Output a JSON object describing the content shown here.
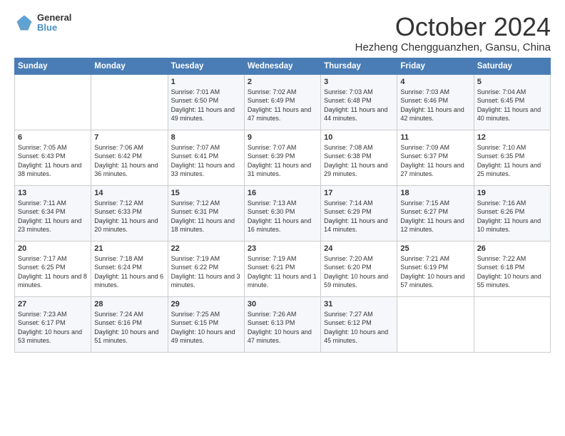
{
  "logo": {
    "general": "General",
    "blue": "Blue"
  },
  "title": "October 2024",
  "location": "Hezheng Chengguanzhen, Gansu, China",
  "weekdays": [
    "Sunday",
    "Monday",
    "Tuesday",
    "Wednesday",
    "Thursday",
    "Friday",
    "Saturday"
  ],
  "weeks": [
    [
      {
        "day": "",
        "sunrise": "",
        "sunset": "",
        "daylight": ""
      },
      {
        "day": "",
        "sunrise": "",
        "sunset": "",
        "daylight": ""
      },
      {
        "day": "1",
        "sunrise": "Sunrise: 7:01 AM",
        "sunset": "Sunset: 6:50 PM",
        "daylight": "Daylight: 11 hours and 49 minutes."
      },
      {
        "day": "2",
        "sunrise": "Sunrise: 7:02 AM",
        "sunset": "Sunset: 6:49 PM",
        "daylight": "Daylight: 11 hours and 47 minutes."
      },
      {
        "day": "3",
        "sunrise": "Sunrise: 7:03 AM",
        "sunset": "Sunset: 6:48 PM",
        "daylight": "Daylight: 11 hours and 44 minutes."
      },
      {
        "day": "4",
        "sunrise": "Sunrise: 7:03 AM",
        "sunset": "Sunset: 6:46 PM",
        "daylight": "Daylight: 11 hours and 42 minutes."
      },
      {
        "day": "5",
        "sunrise": "Sunrise: 7:04 AM",
        "sunset": "Sunset: 6:45 PM",
        "daylight": "Daylight: 11 hours and 40 minutes."
      }
    ],
    [
      {
        "day": "6",
        "sunrise": "Sunrise: 7:05 AM",
        "sunset": "Sunset: 6:43 PM",
        "daylight": "Daylight: 11 hours and 38 minutes."
      },
      {
        "day": "7",
        "sunrise": "Sunrise: 7:06 AM",
        "sunset": "Sunset: 6:42 PM",
        "daylight": "Daylight: 11 hours and 36 minutes."
      },
      {
        "day": "8",
        "sunrise": "Sunrise: 7:07 AM",
        "sunset": "Sunset: 6:41 PM",
        "daylight": "Daylight: 11 hours and 33 minutes."
      },
      {
        "day": "9",
        "sunrise": "Sunrise: 7:07 AM",
        "sunset": "Sunset: 6:39 PM",
        "daylight": "Daylight: 11 hours and 31 minutes."
      },
      {
        "day": "10",
        "sunrise": "Sunrise: 7:08 AM",
        "sunset": "Sunset: 6:38 PM",
        "daylight": "Daylight: 11 hours and 29 minutes."
      },
      {
        "day": "11",
        "sunrise": "Sunrise: 7:09 AM",
        "sunset": "Sunset: 6:37 PM",
        "daylight": "Daylight: 11 hours and 27 minutes."
      },
      {
        "day": "12",
        "sunrise": "Sunrise: 7:10 AM",
        "sunset": "Sunset: 6:35 PM",
        "daylight": "Daylight: 11 hours and 25 minutes."
      }
    ],
    [
      {
        "day": "13",
        "sunrise": "Sunrise: 7:11 AM",
        "sunset": "Sunset: 6:34 PM",
        "daylight": "Daylight: 11 hours and 23 minutes."
      },
      {
        "day": "14",
        "sunrise": "Sunrise: 7:12 AM",
        "sunset": "Sunset: 6:33 PM",
        "daylight": "Daylight: 11 hours and 20 minutes."
      },
      {
        "day": "15",
        "sunrise": "Sunrise: 7:12 AM",
        "sunset": "Sunset: 6:31 PM",
        "daylight": "Daylight: 11 hours and 18 minutes."
      },
      {
        "day": "16",
        "sunrise": "Sunrise: 7:13 AM",
        "sunset": "Sunset: 6:30 PM",
        "daylight": "Daylight: 11 hours and 16 minutes."
      },
      {
        "day": "17",
        "sunrise": "Sunrise: 7:14 AM",
        "sunset": "Sunset: 6:29 PM",
        "daylight": "Daylight: 11 hours and 14 minutes."
      },
      {
        "day": "18",
        "sunrise": "Sunrise: 7:15 AM",
        "sunset": "Sunset: 6:27 PM",
        "daylight": "Daylight: 11 hours and 12 minutes."
      },
      {
        "day": "19",
        "sunrise": "Sunrise: 7:16 AM",
        "sunset": "Sunset: 6:26 PM",
        "daylight": "Daylight: 11 hours and 10 minutes."
      }
    ],
    [
      {
        "day": "20",
        "sunrise": "Sunrise: 7:17 AM",
        "sunset": "Sunset: 6:25 PM",
        "daylight": "Daylight: 11 hours and 8 minutes."
      },
      {
        "day": "21",
        "sunrise": "Sunrise: 7:18 AM",
        "sunset": "Sunset: 6:24 PM",
        "daylight": "Daylight: 11 hours and 6 minutes."
      },
      {
        "day": "22",
        "sunrise": "Sunrise: 7:19 AM",
        "sunset": "Sunset: 6:22 PM",
        "daylight": "Daylight: 11 hours and 3 minutes."
      },
      {
        "day": "23",
        "sunrise": "Sunrise: 7:19 AM",
        "sunset": "Sunset: 6:21 PM",
        "daylight": "Daylight: 11 hours and 1 minute."
      },
      {
        "day": "24",
        "sunrise": "Sunrise: 7:20 AM",
        "sunset": "Sunset: 6:20 PM",
        "daylight": "Daylight: 10 hours and 59 minutes."
      },
      {
        "day": "25",
        "sunrise": "Sunrise: 7:21 AM",
        "sunset": "Sunset: 6:19 PM",
        "daylight": "Daylight: 10 hours and 57 minutes."
      },
      {
        "day": "26",
        "sunrise": "Sunrise: 7:22 AM",
        "sunset": "Sunset: 6:18 PM",
        "daylight": "Daylight: 10 hours and 55 minutes."
      }
    ],
    [
      {
        "day": "27",
        "sunrise": "Sunrise: 7:23 AM",
        "sunset": "Sunset: 6:17 PM",
        "daylight": "Daylight: 10 hours and 53 minutes."
      },
      {
        "day": "28",
        "sunrise": "Sunrise: 7:24 AM",
        "sunset": "Sunset: 6:16 PM",
        "daylight": "Daylight: 10 hours and 51 minutes."
      },
      {
        "day": "29",
        "sunrise": "Sunrise: 7:25 AM",
        "sunset": "Sunset: 6:15 PM",
        "daylight": "Daylight: 10 hours and 49 minutes."
      },
      {
        "day": "30",
        "sunrise": "Sunrise: 7:26 AM",
        "sunset": "Sunset: 6:13 PM",
        "daylight": "Daylight: 10 hours and 47 minutes."
      },
      {
        "day": "31",
        "sunrise": "Sunrise: 7:27 AM",
        "sunset": "Sunset: 6:12 PM",
        "daylight": "Daylight: 10 hours and 45 minutes."
      },
      {
        "day": "",
        "sunrise": "",
        "sunset": "",
        "daylight": ""
      },
      {
        "day": "",
        "sunrise": "",
        "sunset": "",
        "daylight": ""
      }
    ]
  ]
}
